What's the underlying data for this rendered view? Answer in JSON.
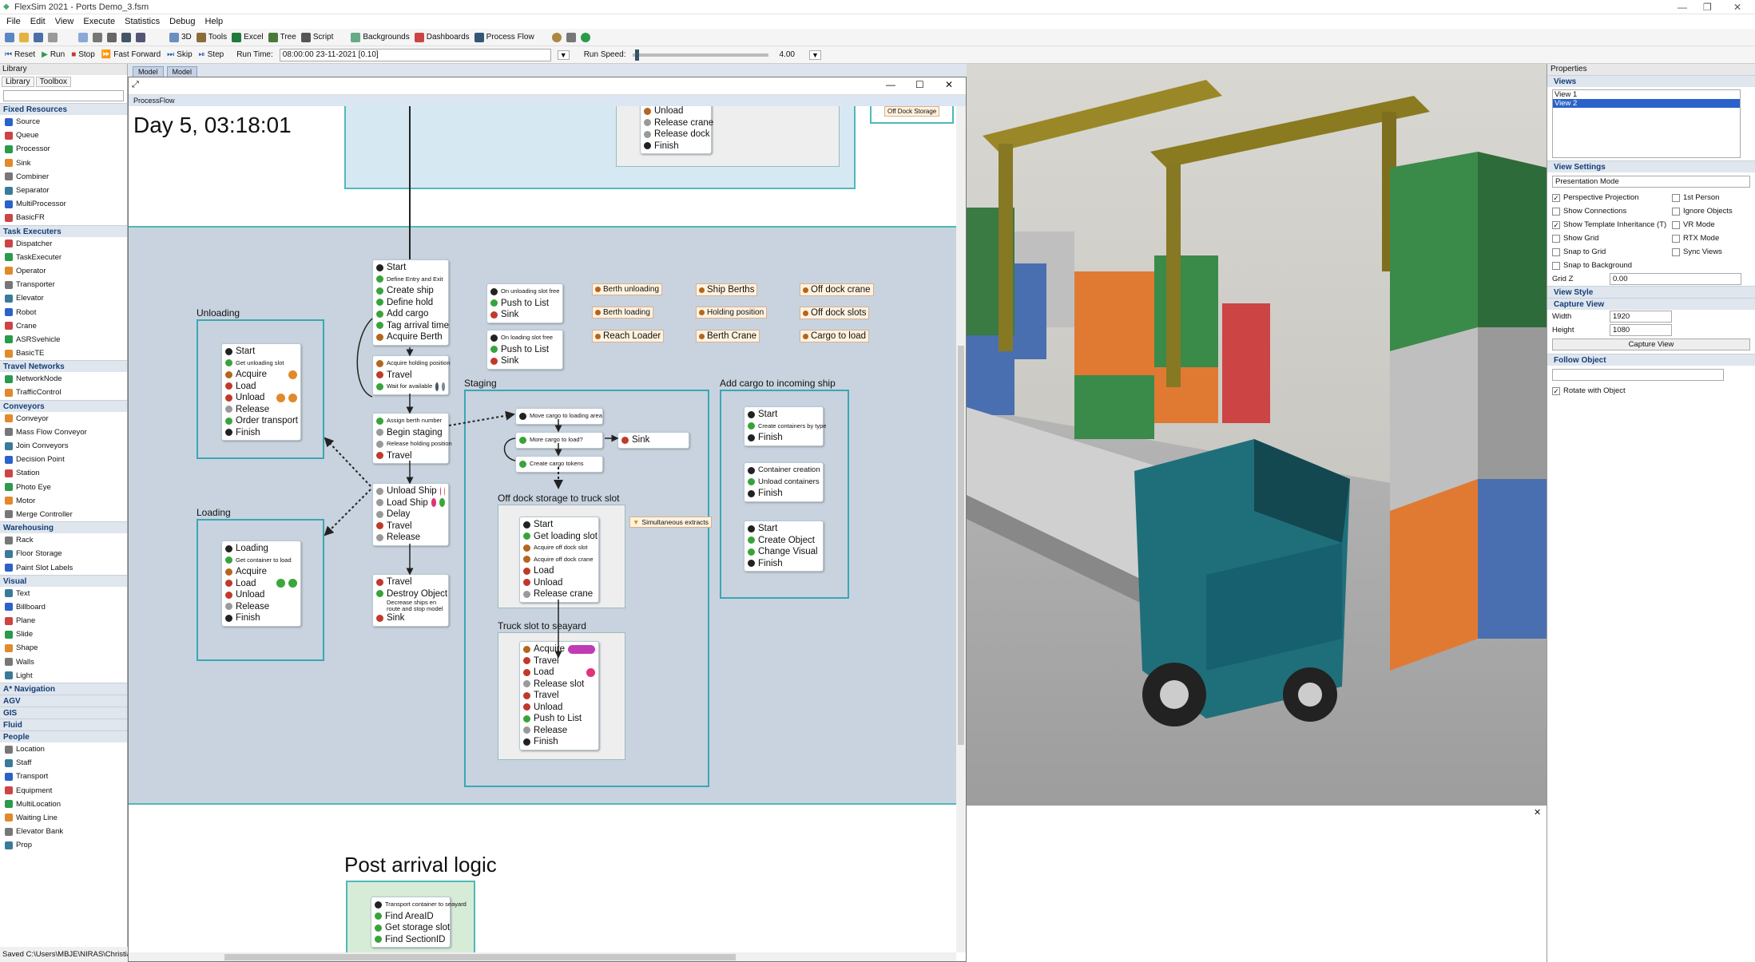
{
  "window": {
    "title": "FlexSim 2021 - Ports Demo_3.fsm"
  },
  "menu": [
    "File",
    "Edit",
    "View",
    "Execute",
    "Statistics",
    "Debug",
    "Help"
  ],
  "toolbar1": [
    {
      "label": "3D",
      "icon": "cube-icon"
    },
    {
      "label": "Tools",
      "icon": "tools-icon"
    },
    {
      "label": "Excel",
      "icon": "excel-icon"
    },
    {
      "label": "Tree",
      "icon": "tree-icon"
    },
    {
      "label": "Script",
      "icon": "script-icon"
    },
    {
      "label": "Backgrounds",
      "icon": "background-icon"
    },
    {
      "label": "Dashboards",
      "icon": "dashboard-icon"
    },
    {
      "label": "Process Flow",
      "icon": "process-flow-icon"
    }
  ],
  "toolbar2": {
    "reset": "Reset",
    "run": "Run",
    "stop": "Stop",
    "fast_forward": "Fast Forward",
    "skip": "Skip",
    "step": "Step",
    "run_time_label": "Run Time:",
    "run_time_value": "08:00:00  23-11-2021  [0.10]",
    "run_speed_label": "Run Speed:",
    "run_speed_value": "4.00"
  },
  "library": {
    "title": "Library",
    "tabs": [
      "Library",
      "Toolbox"
    ],
    "groups": [
      {
        "name": "Fixed Resources",
        "items": [
          "Source",
          "Queue",
          "Processor",
          "Sink",
          "Combiner",
          "Separator",
          "MultiProcessor",
          "BasicFR"
        ]
      },
      {
        "name": "Task Executers",
        "items": [
          "Dispatcher",
          "TaskExecuter",
          "Operator",
          "Transporter",
          "Elevator",
          "Robot",
          "Crane",
          "ASRSvehicle",
          "BasicTE"
        ]
      },
      {
        "name": "Travel Networks",
        "items": [
          "NetworkNode",
          "TrafficControl"
        ]
      },
      {
        "name": "Conveyors",
        "items": [
          "Conveyor",
          "Mass Flow Conveyor",
          "Join Conveyors",
          "Decision Point",
          "Station",
          "Photo Eye",
          "Motor",
          "Merge Controller"
        ]
      },
      {
        "name": "Warehousing",
        "items": [
          "Rack",
          "Floor Storage",
          "Paint Slot Labels"
        ]
      },
      {
        "name": "Visual",
        "items": [
          "Text",
          "Billboard",
          "Plane",
          "Slide",
          "Shape",
          "Walls",
          "Light"
        ]
      },
      {
        "name": "A* Navigation",
        "items": []
      },
      {
        "name": "AGV",
        "items": []
      },
      {
        "name": "GIS",
        "items": []
      },
      {
        "name": "Fluid",
        "items": []
      },
      {
        "name": "People",
        "items": [
          "Location",
          "Staff",
          "Transport",
          "Equipment",
          "MultiLocation",
          "Waiting Line",
          "Elevator Bank",
          "Prop"
        ]
      }
    ]
  },
  "doc_tabs": [
    "Model",
    "Model"
  ],
  "processflow": {
    "tab": "ProcessFlow",
    "clock": "Day 5, 03:18:01",
    "top_block": [
      "Unload",
      "Release crane",
      "Release dock",
      "Finish"
    ],
    "off_dock_label": "Off Dock Storage",
    "main_flow": [
      "Start",
      "Define Entry and Exit",
      "Create ship",
      "Define hold",
      "Add cargo",
      "Tag arrival time",
      "Acquire Berth"
    ],
    "holding_flow": [
      "Acquire holding position",
      "Travel",
      "Wait for available"
    ],
    "berth_flow": [
      "Assign berth number",
      "Begin staging",
      "Release holding position",
      "Travel"
    ],
    "ship_flow": [
      "Unload Ship",
      "Load Ship",
      "Delay",
      "Travel",
      "Release"
    ],
    "exit_flow": [
      "Travel",
      "Destroy Object",
      "Decrease ships en route and stop model",
      "Sink"
    ],
    "slot_free_1": [
      "On unloading slot free",
      "Push to List",
      "Sink"
    ],
    "slot_free_2": [
      "On loading slot free",
      "Push to List",
      "Sink"
    ],
    "resources": [
      "Berth unloading",
      "Berth loading",
      "Reach Loader",
      "Ship Berths",
      "Holding position",
      "Berth Crane",
      "Off dock crane",
      "Off dock slots",
      "Cargo to load"
    ],
    "unloading": {
      "title": "Unloading",
      "items": [
        "Start",
        "Get unloading slot",
        "Acquire",
        "Load",
        "Unload",
        "Release",
        "Order transport",
        "Finish"
      ]
    },
    "loading": {
      "title": "Loading",
      "items": [
        "Loading",
        "Get container to load",
        "Acquire",
        "Load",
        "Unload",
        "Release",
        "Finish"
      ]
    },
    "staging": {
      "title": "Staging",
      "items": [
        "Move cargo to loading area",
        "More cargo to load?",
        "Sink",
        "Create cargo tokens"
      ]
    },
    "offdock": {
      "title": "Off dock storage to truck slot",
      "items": [
        "Start",
        "Get loading slot",
        "Acquire off dock slot",
        "Acquire off dock crane",
        "Load",
        "Unload",
        "Release crane"
      ],
      "sim": "Simultaneous extracts"
    },
    "truck": {
      "title": "Truck slot to seayard",
      "items": [
        "Acquire",
        "Travel",
        "Load",
        "Release slot",
        "Travel",
        "Unload",
        "Push to List",
        "Release",
        "Finish"
      ]
    },
    "addcargo": {
      "title": "Add cargo to incoming ship",
      "g1": [
        "Start",
        "Create containers by type",
        "Finish"
      ],
      "g2": [
        "Container creation",
        "Unload containers",
        "Finish"
      ],
      "g3": [
        "Start",
        "Create Object",
        "Change Visual",
        "Finish"
      ]
    },
    "post": {
      "title": "Post arrival logic",
      "items": [
        "Transport container to seayard",
        "Find AreaID",
        "Get storage slot",
        "Find SectionID"
      ]
    }
  },
  "properties": {
    "title": "Properties",
    "views_title": "Views",
    "views": [
      "View 1",
      "View 2"
    ],
    "selected_view": "View 2",
    "view_settings_title": "View Settings",
    "mode": "Presentation Mode",
    "checks_left": [
      {
        "label": "Perspective Projection",
        "checked": true
      },
      {
        "label": "Show Connections",
        "checked": false
      },
      {
        "label": "Show Template Inheritance (T)",
        "checked": true
      },
      {
        "label": "Show Grid",
        "checked": false
      },
      {
        "label": "Snap to Grid",
        "checked": false
      },
      {
        "label": "Snap to Background",
        "checked": false
      }
    ],
    "checks_right": [
      {
        "label": "1st Person",
        "checked": false
      },
      {
        "label": "Ignore Objects",
        "checked": false
      },
      {
        "label": "VR Mode",
        "checked": false
      },
      {
        "label": "RTX Mode",
        "checked": false
      },
      {
        "label": "Sync Views",
        "checked": false
      }
    ],
    "gridz_label": "Grid Z",
    "gridz": "0.00",
    "view_style_title": "View Style",
    "capture_title": "Capture View",
    "width_label": "Width",
    "width": "1920",
    "height_label": "Height",
    "height": "1080",
    "capture_button": "Capture View",
    "follow_title": "Follow Object",
    "rotate_label": "Rotate with Object"
  },
  "status": "Saved C:\\Users\\MBJE\\NIRAS\\Christian"
}
